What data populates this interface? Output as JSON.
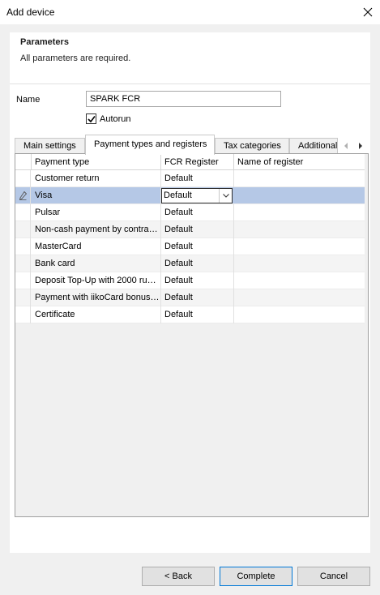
{
  "window": {
    "title": "Add device"
  },
  "parameters": {
    "title": "Parameters",
    "subtitle": "All parameters are required."
  },
  "name_field": {
    "label": "Name",
    "value": "SPARK FCR"
  },
  "autorun": {
    "label": "Autorun",
    "checked": true
  },
  "tabs": [
    {
      "label": "Main settings"
    },
    {
      "label": "Payment types and registers"
    },
    {
      "label": "Tax categories"
    },
    {
      "label": "Additional"
    }
  ],
  "grid": {
    "columns": [
      "Payment type",
      "FCR Register",
      "Name of register"
    ],
    "rows": [
      {
        "payment_type": "Customer return",
        "fcr_register": "Default",
        "name_of_register": ""
      },
      {
        "payment_type": "Visa",
        "fcr_register": "Default",
        "name_of_register": ""
      },
      {
        "payment_type": "Pulsar",
        "fcr_register": "Default",
        "name_of_register": ""
      },
      {
        "payment_type": "Non-cash payment by contra…",
        "fcr_register": "Default",
        "name_of_register": ""
      },
      {
        "payment_type": "MasterCard",
        "fcr_register": "Default",
        "name_of_register": ""
      },
      {
        "payment_type": "Bank card",
        "fcr_register": "Default",
        "name_of_register": ""
      },
      {
        "payment_type": "Deposit Top-Up with 2000 ru…",
        "fcr_register": "Default",
        "name_of_register": ""
      },
      {
        "payment_type": "Payment with iikoCard bonus…",
        "fcr_register": "Default",
        "name_of_register": ""
      },
      {
        "payment_type": "Certificate",
        "fcr_register": "Default",
        "name_of_register": ""
      }
    ]
  },
  "buttons": {
    "back": "< Back",
    "complete": "Complete",
    "cancel": "Cancel"
  },
  "colors": {
    "selected_row": "#b5c8e6",
    "default_button_border": "#0078d7"
  }
}
